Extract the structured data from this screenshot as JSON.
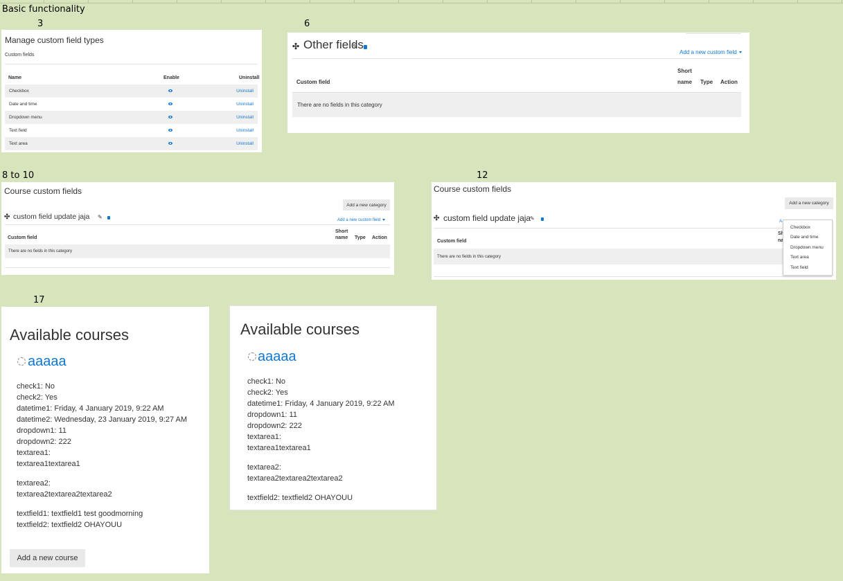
{
  "sheet": {
    "heading": "Basic functionality",
    "labels": [
      "3",
      "6",
      "8 to 10",
      "12",
      "17"
    ]
  },
  "manage_types": {
    "title": "Manage custom field types",
    "subtitle": "Custom fields",
    "headers": {
      "name": "Name",
      "enable": "Enable",
      "uninstall": "Uninstall"
    },
    "rows": [
      {
        "name": "Checkbox",
        "action": "Uninstall"
      },
      {
        "name": "Date and time",
        "action": "Uninstall"
      },
      {
        "name": "Dropdown menu",
        "action": "Uninstall"
      },
      {
        "name": "Text field",
        "action": "Uninstall"
      },
      {
        "name": "Text area",
        "action": "Uninstall"
      }
    ]
  },
  "other_fields": {
    "title": "Other fields",
    "add_link": "Add a new custom field",
    "headers": {
      "custom_field": "Custom field",
      "short_name_1": "Short",
      "short_name_2": "name",
      "type": "Type",
      "action": "Action"
    },
    "empty": "There are no fields in this category"
  },
  "course_fields_a": {
    "title": "Course custom fields",
    "add_category": "Add a new category",
    "category_name": "custom field update jaja",
    "add_link": "Add a new custom field",
    "headers": {
      "custom_field": "Custom field",
      "short_name_1": "Short",
      "short_name_2": "name",
      "type": "Type",
      "action": "Action"
    },
    "empty": "There are no fields in this category"
  },
  "course_fields_b": {
    "title": "Course custom fields",
    "add_category": "Add a new category",
    "category_name": "custom field update jaja",
    "add_link_partial": "A",
    "headers": {
      "custom_field": "Custom field",
      "short_partial_1": "Sh",
      "short_partial_2": "na"
    },
    "empty": "There are no fields in this category",
    "menu": [
      "Checkbox",
      "Date and time",
      "Dropdown menu",
      "Text area",
      "Text field"
    ]
  },
  "courses_a": {
    "title": "Available courses",
    "course": "aaaaa",
    "lines": [
      "check1: No",
      "check2: Yes",
      "datetime1: Friday, 4 January 2019, 9:22 AM",
      "datetime2: Wednesday, 23 January 2019, 9:27 AM",
      "dropdown1: 11",
      "dropdown2: 222",
      "textarea1:",
      "textarea1textarea1",
      "textarea2:",
      "textarea2textarea2textarea2",
      "textfield1: textfield1 test goodmorning",
      "textfield2: textfield2 OHAYOUU"
    ],
    "add_course": "Add a new course"
  },
  "courses_b": {
    "title": "Available courses",
    "course": "aaaaa",
    "lines": [
      "check1: No",
      "check2: Yes",
      "datetime1: Friday, 4 January 2019, 9:22 AM",
      "dropdown1: 11",
      "dropdown2: 222",
      "textarea1:",
      "textarea1textarea1",
      "textarea2:",
      "textarea2textarea2textarea2",
      "textfield2: textfield2 OHAYOUU"
    ]
  }
}
